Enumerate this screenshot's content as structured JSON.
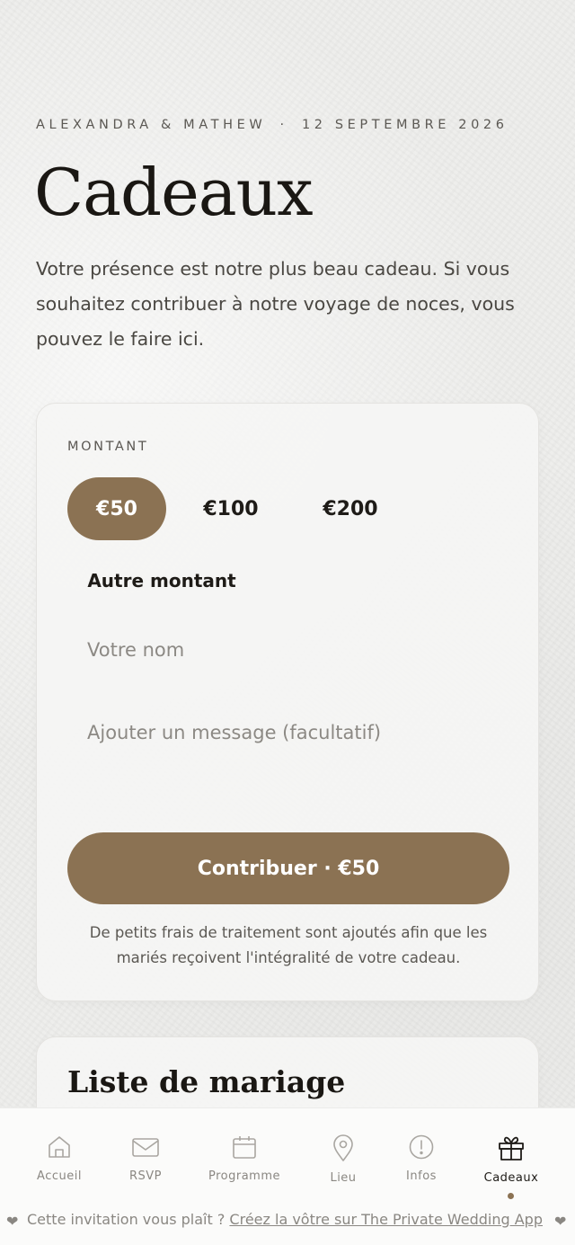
{
  "header": {
    "couple": "ALEXANDRA & MATHEW",
    "separator": "·",
    "date": "12 SEPTEMBRE 2026"
  },
  "page_title": "Cadeaux",
  "intro": "Votre présence est notre plus beau cadeau. Si vous souhaitez contribuer à notre voyage de noces, vous pouvez le faire ici.",
  "gift_form": {
    "amount_label": "MONTANT",
    "amounts": [
      "€50",
      "€100",
      "€200"
    ],
    "selected_amount": "€50",
    "other_amount": "Autre montant",
    "name_placeholder": "Votre nom",
    "message_placeholder": "Ajouter un message (facultatif)",
    "submit_label": "Contribuer · €50",
    "fee_note": "De petits frais de traitement sont ajoutés afin que les mariés reçoivent l'intégralité de votre cadeau."
  },
  "registry": {
    "title": "Liste de mariage"
  },
  "nav": {
    "items": [
      {
        "label": "Accueil",
        "icon": "home-icon"
      },
      {
        "label": "RSVP",
        "icon": "mail-icon"
      },
      {
        "label": "Programme",
        "icon": "calendar-icon"
      },
      {
        "label": "Lieu",
        "icon": "location-pin-icon"
      },
      {
        "label": "Infos",
        "icon": "info-alert-icon"
      },
      {
        "label": "Cadeaux",
        "icon": "gift-icon"
      }
    ],
    "active": "Cadeaux"
  },
  "footer": {
    "heart": "❤",
    "text": "Cette invitation vous plaît ?",
    "link": "Créez la vôtre sur The Private Wedding App"
  },
  "colors": {
    "accent": "#8b7253",
    "background": "#eeeeec",
    "text": "#1e1b17",
    "muted": "#8a8782"
  }
}
